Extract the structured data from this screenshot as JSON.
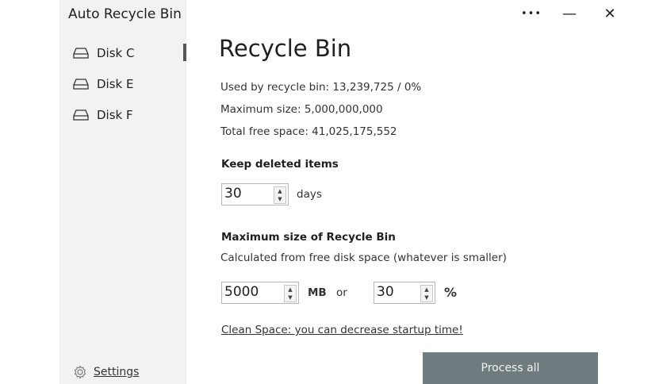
{
  "app": {
    "title": "Auto Recycle Bin"
  },
  "window_controls": {
    "more": "•••",
    "minimize": "—",
    "close": "✕"
  },
  "sidebar": {
    "items": [
      {
        "label": "Disk C",
        "icon": "drive-icon",
        "selected": true
      },
      {
        "label": "Disk E",
        "icon": "drive-icon",
        "selected": false
      },
      {
        "label": "Disk F",
        "icon": "drive-icon",
        "selected": false
      }
    ],
    "settings_label": "Settings"
  },
  "main": {
    "title": "Recycle Bin",
    "used_line": "Used by recycle bin: 13,239,725 / 0%",
    "max_size_line": "Maximum size: 5,000,000,000",
    "free_space_line": "Total free space: 41,025,175,552",
    "keep_section": {
      "title": "Keep deleted items",
      "value": "30",
      "unit": "days"
    },
    "max_section": {
      "title": "Maximum size of Recycle Bin",
      "description": "Calculated from free disk space (whatever is smaller)",
      "mb_value": "5000",
      "mb_unit": "MB",
      "or_label": "or",
      "percent_value": "30",
      "percent_unit": "%"
    },
    "clean_link": "Clean Space: you can decrease startup time!",
    "process_button": "Process all"
  },
  "colors": {
    "sidebar_bg": "#f2f2f2",
    "button_bg": "#6e7b7f",
    "button_text": "#f2f2f2"
  }
}
